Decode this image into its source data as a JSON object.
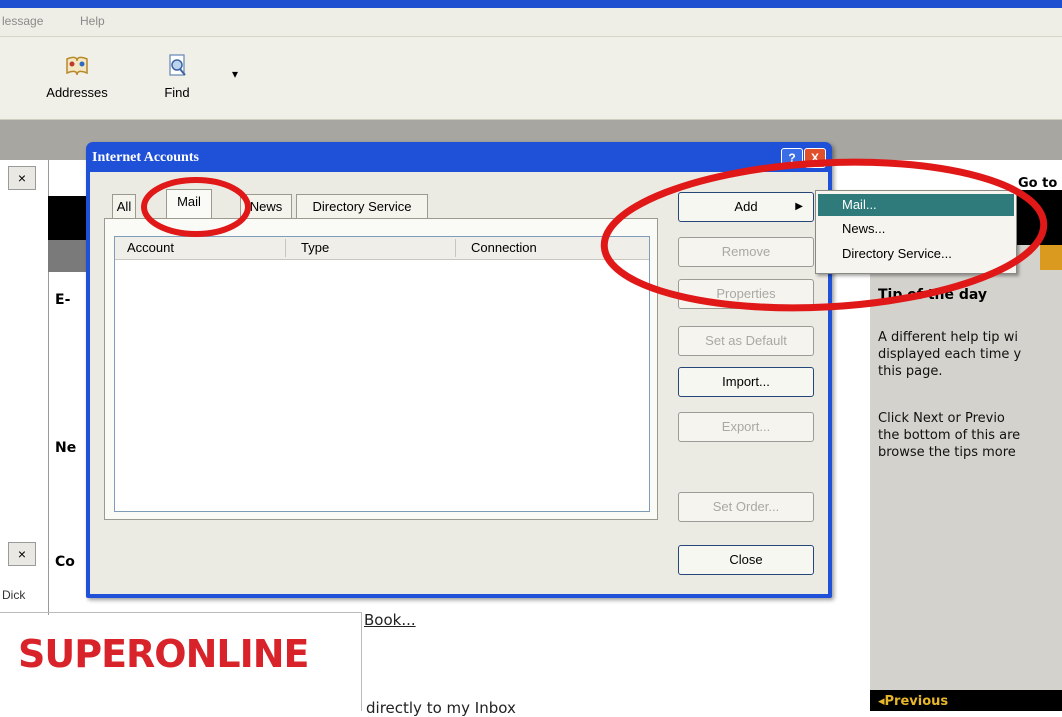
{
  "menubar": {
    "items": [
      "lessage",
      "Help"
    ]
  },
  "toolbar": {
    "addresses_label": "Addresses",
    "find_label": "Find",
    "dropdown_glyph": "▾"
  },
  "background": {
    "close_glyph": "×",
    "side_labels": [
      "E-",
      "Ne",
      "Co"
    ],
    "click_text": "Dick",
    "go_to": "Go to",
    "tip_title": "Tip of the day",
    "tip_lines": [
      "A different help tip wi",
      "displayed each time y",
      "this page.",
      "",
      "Click Next or Previo",
      "the bottom of this are",
      "browse the tips more"
    ],
    "previous_link": "◂Previous",
    "book_link": "Book...",
    "inbox_text": "directly to my Inbox",
    "logo": "SUPERONLINE"
  },
  "dialog": {
    "title": "Internet Accounts",
    "help_glyph": "?",
    "close_glyph": "X",
    "tabs": [
      {
        "label": "All",
        "active": false
      },
      {
        "label": "Mail",
        "active": true
      },
      {
        "label": "News",
        "active": false
      },
      {
        "label": "Directory Service",
        "active": false
      }
    ],
    "columns": [
      "Account",
      "Type",
      "Connection"
    ],
    "buttons": {
      "add": "Add",
      "remove": "Remove",
      "properties": "Properties",
      "set_default": "Set as Default",
      "import": "Import...",
      "export": "Export...",
      "set_order": "Set Order...",
      "close": "Close"
    }
  },
  "add_menu": {
    "items": [
      {
        "label": "Mail...",
        "selected": true
      },
      {
        "label": "News...",
        "selected": false
      },
      {
        "label": "Directory Service...",
        "selected": false
      }
    ]
  },
  "colors": {
    "dialog_title_bar": "#1f50d8",
    "menu_highlight": "#2f7a7a",
    "annotation_circle": "#e01818",
    "logo_red": "#d8232a"
  }
}
